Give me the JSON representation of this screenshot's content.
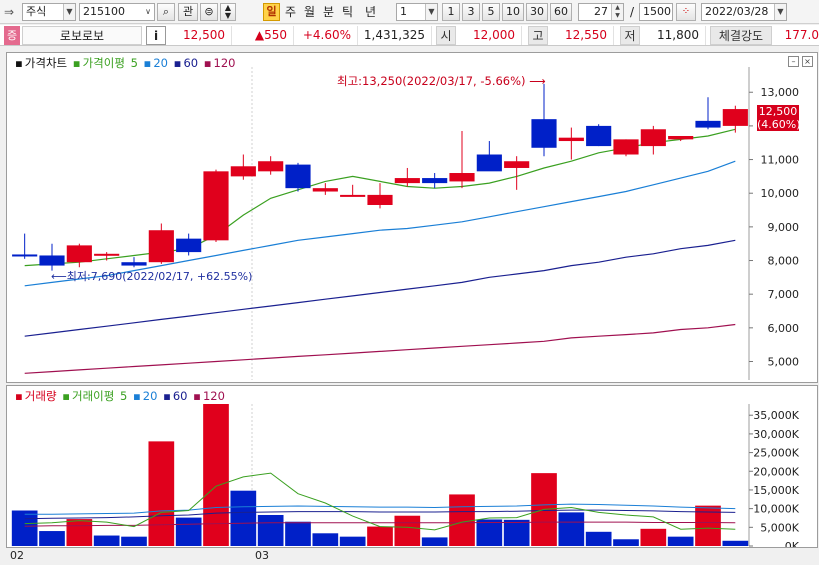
{
  "toolbar": {
    "market_type": "주식",
    "stock_code": "215100",
    "btn_interest": "관",
    "period_tabs": [
      "일",
      "주",
      "월",
      "분",
      "틱",
      "년"
    ],
    "interval_value": "1",
    "interval_buttons": [
      "1",
      "3",
      "5",
      "10",
      "30",
      "60"
    ],
    "display_count": "27",
    "slash": "/",
    "total_count": "1500",
    "date": "2022/03/28"
  },
  "quote": {
    "badge": "증",
    "name": "로보로보",
    "info": "i",
    "price": "12,500",
    "change": "▲550",
    "change_pct": "+4.60%",
    "volume": "1,431,325",
    "open_label": "시",
    "open": "12,000",
    "high_label": "고",
    "high": "12,550",
    "low_label": "저",
    "low": "11,800",
    "strength_label": "체결강도",
    "strength": "177.0"
  },
  "price_panel": {
    "legend": [
      "가격차트",
      "가격이평",
      "5",
      "20",
      "60",
      "120"
    ],
    "legend_colors": [
      "#111111",
      "#3aa020",
      "#3aa020",
      "#1a7fd6",
      "#1a2090",
      "#a01050"
    ],
    "high_annotation": "최고:13,250(2022/03/17, -5.66%)",
    "low_annotation": "최저:7,690(2022/02/17, +62.55%)",
    "current_price": "12,500",
    "current_pct": "(4.60%)"
  },
  "volume_panel": {
    "legend": [
      "거래량",
      "거래이평",
      "5",
      "20",
      "60",
      "120"
    ],
    "legend_colors": [
      "#d6001c",
      "#3aa020",
      "#3aa020",
      "#1a7fd6",
      "#1a2090",
      "#a01050"
    ]
  },
  "x_labels": [
    "02",
    "03"
  ],
  "chart_data": [
    {
      "type": "candlestick",
      "y_ticks": [
        5000,
        6000,
        7000,
        8000,
        9000,
        10000,
        11000,
        12000,
        13000
      ],
      "y_tick_labels": [
        "5,000",
        "6,000",
        "7,000",
        "8,000",
        "9,000",
        "10,000",
        "11,000",
        "12,000",
        "13,000"
      ],
      "ylim": [
        4450,
        13750
      ],
      "candles": [
        {
          "o": 8180,
          "h": 8800,
          "l": 8050,
          "c": 8120
        },
        {
          "o": 8150,
          "h": 8500,
          "l": 7700,
          "c": 7850
        },
        {
          "o": 7950,
          "h": 8500,
          "l": 7800,
          "c": 8450
        },
        {
          "o": 8150,
          "h": 8250,
          "l": 8000,
          "c": 8200
        },
        {
          "o": 7950,
          "h": 8100,
          "l": 7800,
          "c": 7850
        },
        {
          "o": 7950,
          "h": 9100,
          "l": 7900,
          "c": 8900
        },
        {
          "o": 8650,
          "h": 8800,
          "l": 8150,
          "c": 8250
        },
        {
          "o": 8600,
          "h": 10700,
          "l": 8550,
          "c": 10650
        },
        {
          "o": 10500,
          "h": 11150,
          "l": 10400,
          "c": 10800
        },
        {
          "o": 10650,
          "h": 11100,
          "l": 10550,
          "c": 10950
        },
        {
          "o": 10850,
          "h": 10900,
          "l": 10050,
          "c": 10150
        },
        {
          "o": 10050,
          "h": 10300,
          "l": 9950,
          "c": 10150
        },
        {
          "o": 9950,
          "h": 10250,
          "l": 9900,
          "c": 9950
        },
        {
          "o": 9650,
          "h": 10300,
          "l": 9550,
          "c": 9950
        },
        {
          "o": 10300,
          "h": 10750,
          "l": 10200,
          "c": 10450
        },
        {
          "o": 10450,
          "h": 10600,
          "l": 10150,
          "c": 10300
        },
        {
          "o": 10350,
          "h": 11850,
          "l": 10150,
          "c": 10600
        },
        {
          "o": 11150,
          "h": 11550,
          "l": 10700,
          "c": 10650
        },
        {
          "o": 10750,
          "h": 11100,
          "l": 10100,
          "c": 10950
        },
        {
          "o": 12200,
          "h": 13250,
          "l": 11100,
          "c": 11350
        },
        {
          "o": 11550,
          "h": 11950,
          "l": 11000,
          "c": 11650
        },
        {
          "o": 12000,
          "h": 12050,
          "l": 11400,
          "c": 11400
        },
        {
          "o": 11150,
          "h": 11600,
          "l": 11100,
          "c": 11600
        },
        {
          "o": 11400,
          "h": 12000,
          "l": 11150,
          "c": 11900
        },
        {
          "o": 11600,
          "h": 11700,
          "l": 11550,
          "c": 11700
        },
        {
          "o": 12150,
          "h": 12850,
          "l": 11900,
          "c": 11950
        },
        {
          "o": 12000,
          "h": 12600,
          "l": 11800,
          "c": 12500
        }
      ],
      "ma5": [
        7850,
        7900,
        7950,
        8050,
        8150,
        8250,
        8350,
        8750,
        9350,
        9850,
        10100,
        10350,
        10500,
        10350,
        10200,
        10150,
        10200,
        10300,
        10500,
        10750,
        10950,
        11200,
        11350,
        11500,
        11600,
        11700,
        11900
      ],
      "ma20": [
        7250,
        7350,
        7450,
        7550,
        7700,
        7850,
        8000,
        8150,
        8300,
        8450,
        8600,
        8700,
        8800,
        8900,
        8950,
        9050,
        9150,
        9300,
        9450,
        9600,
        9750,
        9900,
        10050,
        10250,
        10450,
        10650,
        10950
      ],
      "ma60": [
        5750,
        5850,
        5950,
        6050,
        6150,
        6250,
        6350,
        6450,
        6550,
        6650,
        6750,
        6850,
        6950,
        7050,
        7150,
        7250,
        7350,
        7500,
        7600,
        7700,
        7850,
        7950,
        8100,
        8200,
        8350,
        8450,
        8600
      ],
      "ma120": [
        4650,
        4700,
        4750,
        4800,
        4850,
        4900,
        4950,
        5000,
        5050,
        5100,
        5150,
        5200,
        5250,
        5300,
        5350,
        5400,
        5450,
        5500,
        5550,
        5600,
        5700,
        5750,
        5800,
        5850,
        5950,
        6000,
        6100
      ]
    },
    {
      "type": "bar",
      "y_ticks": [
        0,
        5000,
        10000,
        15000,
        20000,
        25000,
        30000,
        35000
      ],
      "y_tick_labels": [
        "0K",
        "5,000K",
        "10,000K",
        "15,000K",
        "20,000K",
        "25,000K",
        "30,000K",
        "35,000K"
      ],
      "ylim": [
        0,
        38000
      ],
      "values": [
        9500,
        4000,
        7200,
        2800,
        2500,
        28000,
        7600,
        38000,
        14800,
        8300,
        6500,
        3400,
        2500,
        5200,
        8100,
        2300,
        13800,
        7100,
        7000,
        19500,
        9000,
        3800,
        1800,
        4600,
        2500,
        10800,
        1400
      ],
      "colors": [
        "b",
        "b",
        "r",
        "b",
        "b",
        "r",
        "b",
        "r",
        "b",
        "b",
        "b",
        "b",
        "b",
        "r",
        "r",
        "b",
        "r",
        "b",
        "b",
        "r",
        "b",
        "b",
        "b",
        "r",
        "b",
        "r",
        "b"
      ],
      "ma5": [
        6000,
        6200,
        6800,
        6400,
        5200,
        9000,
        9500,
        16000,
        18500,
        19500,
        14000,
        11500,
        8000,
        5200,
        5000,
        4300,
        6400,
        7500,
        7600,
        9800,
        10300,
        9000,
        8300,
        7800,
        4500,
        4800,
        4500
      ],
      "ma20": [
        8500,
        8500,
        8600,
        8700,
        8800,
        9400,
        9600,
        10300,
        10500,
        10600,
        10700,
        10600,
        10500,
        10400,
        10400,
        10300,
        10500,
        10600,
        10700,
        11000,
        11200,
        11100,
        10900,
        10700,
        10400,
        10200,
        10000
      ],
      "ma60": [
        7300,
        7400,
        7500,
        7600,
        7800,
        8100,
        8300,
        8800,
        9000,
        9100,
        9200,
        9200,
        9200,
        9100,
        9100,
        9100,
        9200,
        9200,
        9300,
        9500,
        9600,
        9600,
        9500,
        9400,
        9200,
        9100,
        9000
      ],
      "ma120": [
        5300,
        5400,
        5400,
        5500,
        5500,
        5700,
        5800,
        6000,
        6100,
        6200,
        6200,
        6200,
        6200,
        6200,
        6200,
        6200,
        6200,
        6300,
        6300,
        6400,
        6400,
        6400,
        6400,
        6300,
        6300,
        6300,
        6200
      ]
    }
  ]
}
